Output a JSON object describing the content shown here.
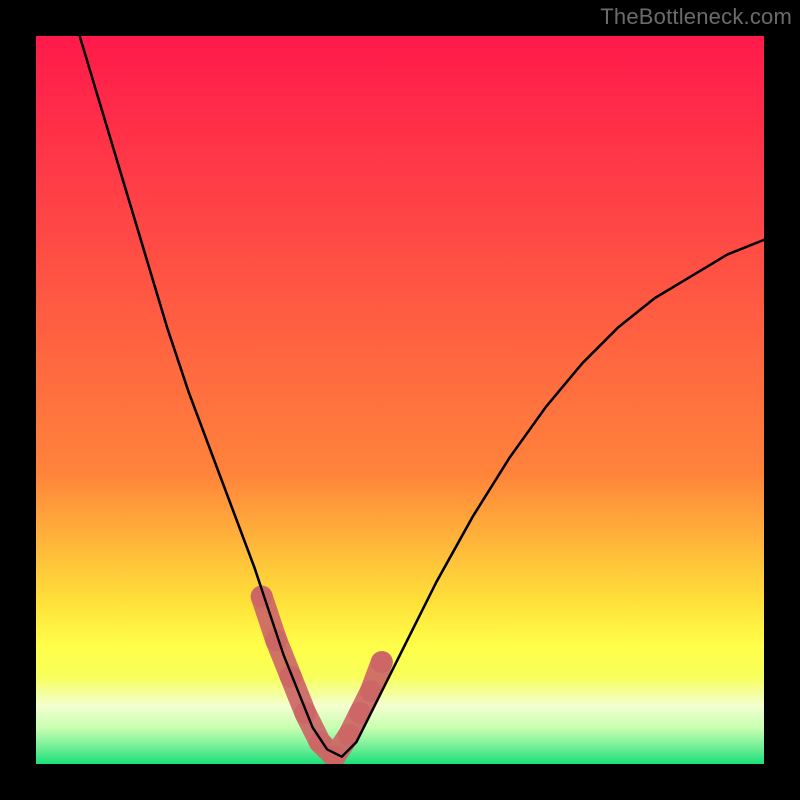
{
  "watermark": "TheBottleneck.com",
  "colors": {
    "background": "#000000",
    "gradient_top": "#ff1a4b",
    "gradient_upper_mid": "#ff833b",
    "gradient_mid": "#ffe23a",
    "gradient_low": "#f8ff5a",
    "gradient_pale": "#f3ffd0",
    "gradient_bottom": "#19e07a",
    "curve_stroke": "#000000",
    "marker_fill": "#cc6666",
    "watermark_text": "#6b6b6b"
  },
  "chart_data": {
    "type": "line",
    "title": "",
    "xlabel": "",
    "ylabel": "",
    "xlim": [
      0,
      100
    ],
    "ylim": [
      0,
      100
    ],
    "series": [
      {
        "name": "bottleneck-curve",
        "x": [
          6,
          9,
          12,
          15,
          18,
          21,
          24,
          27,
          30,
          32,
          34,
          36,
          38,
          40,
          42,
          44,
          46,
          50,
          55,
          60,
          65,
          70,
          75,
          80,
          85,
          90,
          95,
          100
        ],
        "y": [
          100,
          90,
          80,
          70,
          60,
          51,
          43,
          35,
          27,
          21,
          15,
          10,
          5,
          2,
          1,
          3,
          7,
          15,
          25,
          34,
          42,
          49,
          55,
          60,
          64,
          67,
          70,
          72
        ]
      }
    ],
    "markers": {
      "name": "highlighted-range",
      "x": [
        31,
        33,
        35,
        37,
        39,
        41,
        43,
        44.5,
        46,
        47.5
      ],
      "y": [
        23,
        17,
        12,
        7,
        3,
        1,
        4,
        7,
        10,
        14
      ]
    },
    "gradient_stops_pct": [
      0,
      28,
      60,
      78,
      84,
      88,
      92,
      95,
      97.5,
      100
    ],
    "legend": null,
    "grid": false
  }
}
